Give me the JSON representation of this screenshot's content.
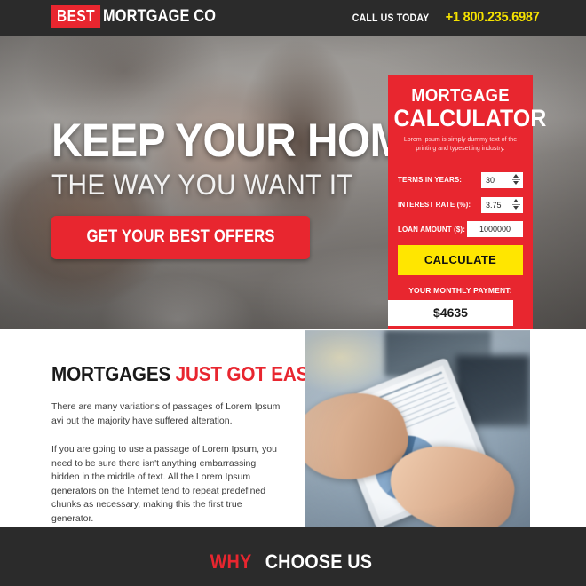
{
  "header": {
    "logo_badge": "BEST",
    "logo_text": "MORTGAGE CO",
    "call_label": "CALL US TODAY",
    "phone": "+1 800.235.6987",
    "brand_red": "#E8262F",
    "phone_yellow": "#F5E200",
    "bar_dark": "#2B2B2B"
  },
  "hero": {
    "headline": "KEEP YOUR HOME",
    "subheadline": "THE WAY YOU WANT IT",
    "cta_label": "GET YOUR BEST OFFERS",
    "photo_alt": "couple-photo"
  },
  "calculator": {
    "title_line1": "MORTGAGE",
    "title_line2": "CALCULATOR",
    "description": "Lorem Ipsum is simply dummy text of the printing and typesetting industry.",
    "fields": [
      {
        "label": "TERMS IN YEARS:",
        "value": "30",
        "spinner": true
      },
      {
        "label": "INTEREST RATE (%):",
        "value": "3.75",
        "spinner": true
      },
      {
        "label": "LOAN AMOUNT ($):",
        "value": "1000000",
        "spinner": false
      }
    ],
    "button_label": "CALCULATE",
    "payment_label": "YOUR MONTHLY PAYMENT:",
    "payment_value": "$4635",
    "panel_red": "#E8262F",
    "button_yellow": "#FFE600"
  },
  "mid": {
    "heading_dark": "MORTGAGES",
    "heading_red": "JUST GOT EASIER",
    "paragraph1": "There are many variations of passages of Lorem Ipsum avi but the majority have suffered alteration.",
    "paragraph2": "If you are going to use a passage of Lorem Ipsum, you need to be sure there isn't anything embarrassing hidden in the middle of text. All the Lorem Ipsum generators on the Internet tend to repeat predefined chunks as necessary, making this the first true generator.",
    "image_alt": "hands-holding-tablet-with-chart"
  },
  "footer": {
    "why_red": "WHY",
    "why_white": "CHOOSE US",
    "bar_dark": "#2B2B2B"
  }
}
